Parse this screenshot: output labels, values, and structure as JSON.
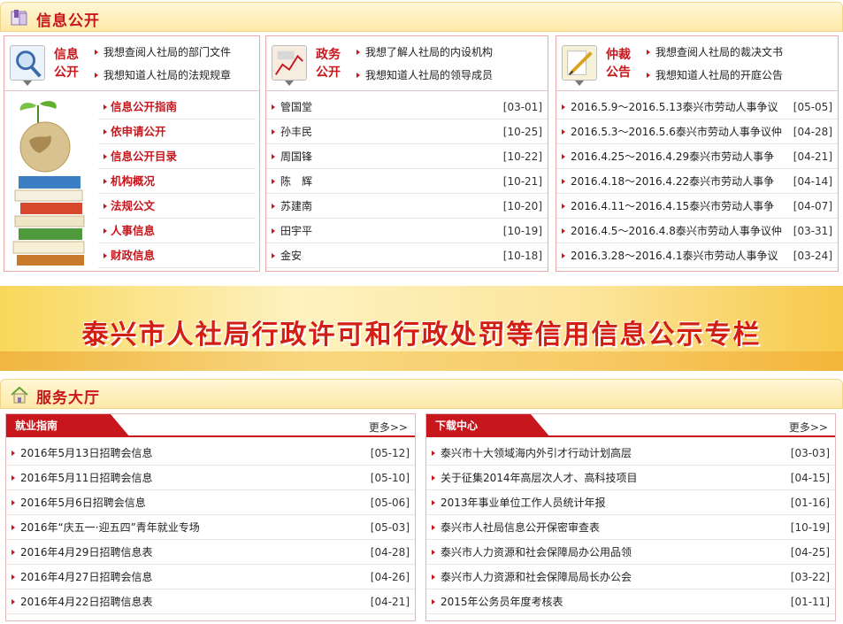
{
  "info_section": {
    "title": "信息公开",
    "panels": [
      {
        "title": "信息公开",
        "links": [
          "我想查阅人社局的部门文件",
          "我想知道人社局的法规规章"
        ],
        "categories": [
          "信息公开指南",
          "依申请公开",
          "信息公开目录",
          "机构概况",
          "法规公文",
          "人事信息",
          "财政信息"
        ]
      },
      {
        "title": "政务公开",
        "links": [
          "我想了解人社局的内设机构",
          "我想知道人社局的领导成员"
        ],
        "rows": [
          {
            "text": "管国堂",
            "date": "[03-01]"
          },
          {
            "text": "孙丰民",
            "date": "[10-25]"
          },
          {
            "text": "周国锋",
            "date": "[10-22]"
          },
          {
            "text": "陈　辉",
            "date": "[10-21]"
          },
          {
            "text": "苏建南",
            "date": "[10-20]"
          },
          {
            "text": "田宇平",
            "date": "[10-19]"
          },
          {
            "text": "金安",
            "date": "[10-18]"
          }
        ]
      },
      {
        "title": "仲裁公告",
        "links": [
          "我想查阅人社局的裁决文书",
          "我想知道人社局的开庭公告"
        ],
        "rows": [
          {
            "text": "2016.5.9～2016.5.13泰兴市劳动人事争议",
            "date": "[05-05]"
          },
          {
            "text": "2016.5.3～2016.5.6泰兴市劳动人事争议仲",
            "date": "[04-28]"
          },
          {
            "text": "2016.4.25～2016.4.29泰兴市劳动人事争",
            "date": "[04-21]"
          },
          {
            "text": "2016.4.18～2016.4.22泰兴市劳动人事争",
            "date": "[04-14]"
          },
          {
            "text": "2016.4.11～2016.4.15泰兴市劳动人事争",
            "date": "[04-07]"
          },
          {
            "text": "2016.4.5～2016.4.8泰兴市劳动人事争议仲",
            "date": "[03-31]"
          },
          {
            "text": "2016.3.28～2016.4.1泰兴市劳动人事争议",
            "date": "[03-24]"
          }
        ]
      }
    ]
  },
  "banner": {
    "text": "泰兴市人社局行政许可和行政处罚等信用信息公示专栏"
  },
  "service_section": {
    "title": "服务大厅",
    "more_label": "更多>>",
    "columns": [
      {
        "tab": "就业指南",
        "rows": [
          {
            "text": "2016年5月13日招聘会信息",
            "date": "[05-12]"
          },
          {
            "text": "2016年5月11日招聘会信息",
            "date": "[05-10]"
          },
          {
            "text": "2016年5月6日招聘会信息",
            "date": "[05-06]"
          },
          {
            "text": "2016年“庆五一·迎五四”青年就业专场",
            "date": "[05-03]"
          },
          {
            "text": "2016年4月29日招聘信息表",
            "date": "[04-28]"
          },
          {
            "text": "2016年4月27日招聘会信息",
            "date": "[04-26]"
          },
          {
            "text": "2016年4月22日招聘信息表",
            "date": "[04-21]"
          }
        ]
      },
      {
        "tab": "下载中心",
        "rows": [
          {
            "text": "泰兴市十大领域海内外引才行动计划高层",
            "date": "[03-03]"
          },
          {
            "text": "关于征集2014年高层次人才、高科技项目",
            "date": "[04-15]"
          },
          {
            "text": "2013年事业单位工作人员统计年报",
            "date": "[01-16]"
          },
          {
            "text": "泰兴市人社局信息公开保密审查表",
            "date": "[10-19]"
          },
          {
            "text": "泰兴市人力资源和社会保障局办公用品领",
            "date": "[04-25]"
          },
          {
            "text": "泰兴市人力资源和社会保障局局长办公会",
            "date": "[03-22]"
          },
          {
            "text": "2015年公务员年度考核表",
            "date": "[01-11]"
          }
        ]
      }
    ]
  },
  "colors": {
    "accent": "#c8161d",
    "header_bg": "#fde9a8",
    "banner_text": "#d21f14"
  }
}
